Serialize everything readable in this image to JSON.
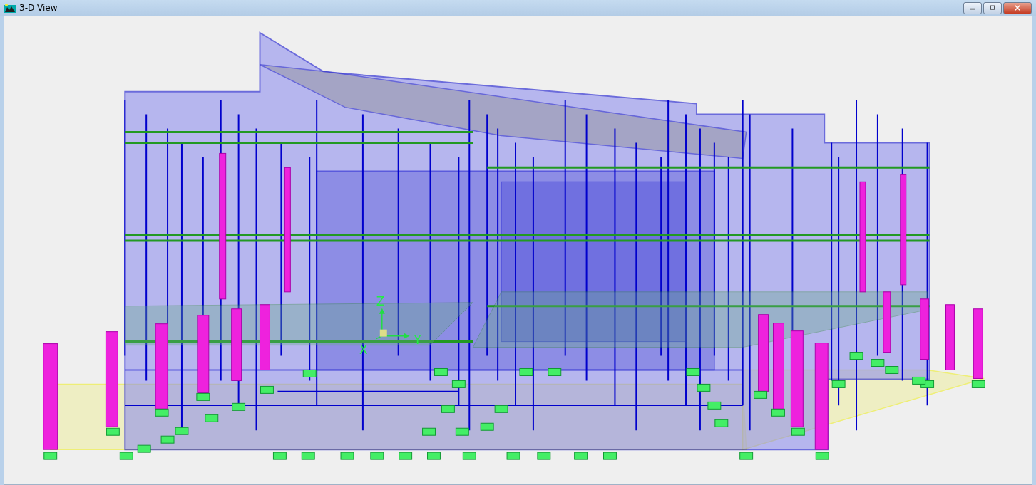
{
  "window": {
    "title": "3-D View"
  },
  "axes": {
    "z_label": "Z",
    "x_label": "X",
    "y_label": "Y"
  }
}
